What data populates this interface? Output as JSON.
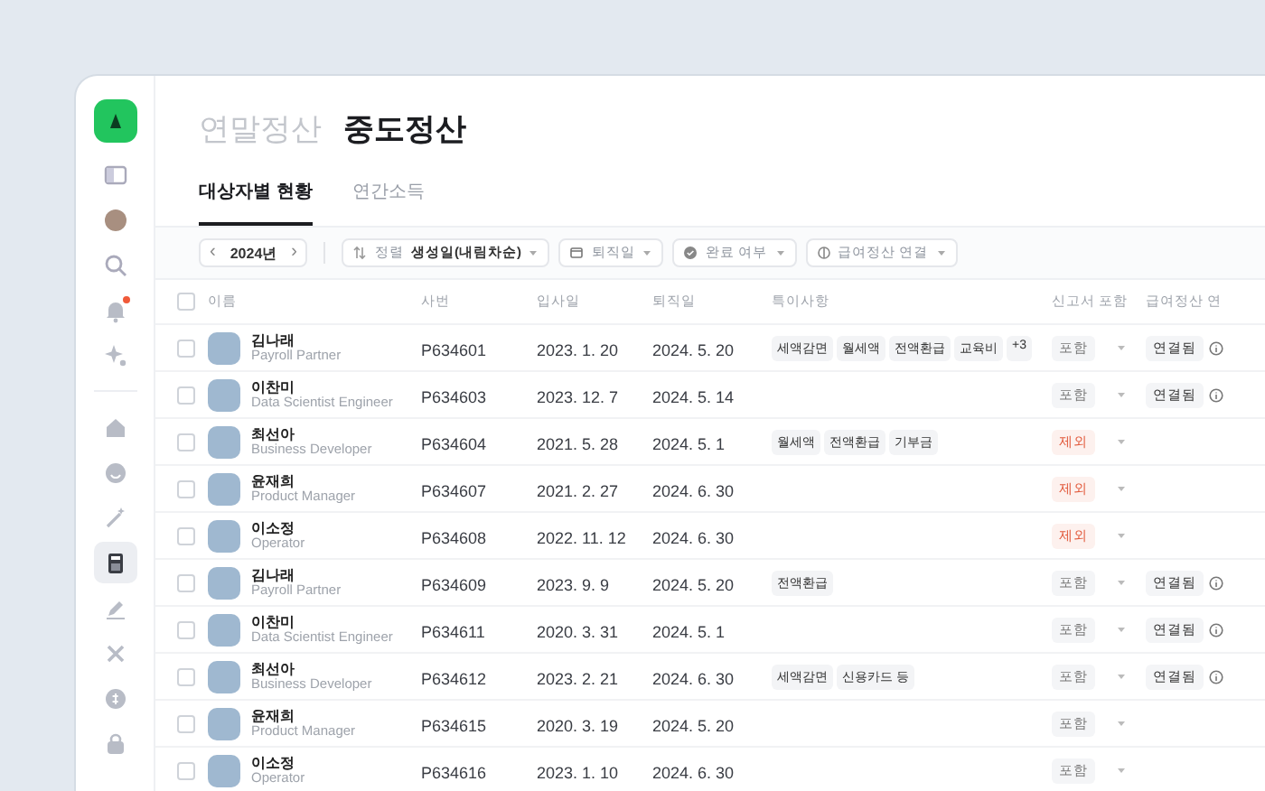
{
  "sidebar": {
    "items": [
      {
        "selected": false,
        "alert": false
      },
      {
        "selected": false,
        "alert": false
      },
      {
        "selected": false,
        "alert": false
      },
      {
        "selected": false,
        "alert": true
      },
      {
        "selected": false,
        "alert": false
      },
      {
        "selected": false,
        "alert": false
      },
      {
        "selected": false,
        "alert": false
      },
      {
        "selected": false,
        "alert": false
      },
      {
        "selected": true,
        "alert": false
      },
      {
        "selected": false,
        "alert": false
      },
      {
        "selected": false,
        "alert": false
      },
      {
        "selected": false,
        "alert": false
      },
      {
        "selected": false,
        "alert": false
      }
    ]
  },
  "title_tabs": [
    {
      "label": "연말정산",
      "selected": false
    },
    {
      "label": "중도정산",
      "selected": true
    }
  ],
  "tabs": [
    {
      "label": "대상자별 현황",
      "selected": true
    },
    {
      "label": "연간소득",
      "selected": false
    }
  ],
  "filters": {
    "year": "2024년",
    "prev": "‹",
    "next": "›",
    "dropdowns": [
      {
        "label": "정렬",
        "value": "생성일(내림차순)"
      },
      {
        "label": "퇴직일"
      },
      {
        "label": "완료 여부"
      },
      {
        "label": "급여정산 연결"
      }
    ]
  },
  "table": {
    "header_checked": false,
    "columns": [
      "이름",
      "사번",
      "입사일",
      "퇴직일",
      "특이사항",
      "신고서 포함",
      "급여정산 연"
    ],
    "rows": [
      {
        "checked": false,
        "name": "김나래",
        "role": "Payroll Partner",
        "id": "P634601",
        "hired": "2023. 1. 20",
        "left": "2024. 5. 20",
        "notes": [
          "세액감면",
          "월세액",
          "전액환급",
          "교육비",
          "+3"
        ],
        "report": "포함",
        "included": true,
        "link": "연결됨"
      },
      {
        "checked": false,
        "name": "이찬미",
        "role": "Data Scientist Engineer",
        "id": "P634603",
        "hired": "2023. 12. 7",
        "left": "2024. 5. 14",
        "notes": [],
        "report": "포함",
        "included": true,
        "link": "연결됨"
      },
      {
        "checked": false,
        "name": "최선아",
        "role": "Business Developer",
        "id": "P634604",
        "hired": "2021. 5. 28",
        "left": "2024. 5. 1",
        "notes": [
          "월세액",
          "전액환급",
          "기부금"
        ],
        "report": "제외",
        "included": false
      },
      {
        "checked": false,
        "name": "윤재희",
        "role": "Product Manager",
        "id": "P634607",
        "hired": "2021. 2. 27",
        "left": "2024. 6. 30",
        "notes": [],
        "report": "제외",
        "included": false
      },
      {
        "checked": false,
        "name": "이소정",
        "role": "Operator",
        "id": "P634608",
        "hired": "2022. 11. 12",
        "left": "2024. 6. 30",
        "notes": [],
        "report": "제외",
        "included": false
      },
      {
        "checked": false,
        "name": "김나래",
        "role": "Payroll Partner",
        "id": "P634609",
        "hired": "2023. 9. 9",
        "left": "2024. 5. 20",
        "notes": [
          "전액환급"
        ],
        "report": "포함",
        "included": true,
        "link": "연결됨"
      },
      {
        "checked": false,
        "name": "이찬미",
        "role": "Data Scientist Engineer",
        "id": "P634611",
        "hired": "2020. 3. 31",
        "left": "2024. 5. 1",
        "notes": [],
        "report": "포함",
        "included": true,
        "link": "연결됨"
      },
      {
        "checked": false,
        "name": "최선아",
        "role": "Business Developer",
        "id": "P634612",
        "hired": "2023. 2. 21",
        "left": "2024. 6. 30",
        "notes": [
          "세액감면",
          "신용카드 등"
        ],
        "report": "포함",
        "included": true,
        "link": "연결됨"
      },
      {
        "checked": false,
        "name": "윤재희",
        "role": "Product Manager",
        "id": "P634615",
        "hired": "2020. 3. 19",
        "left": "2024. 5. 20",
        "notes": [],
        "report": "포함",
        "included": true
      },
      {
        "checked": false,
        "name": "이소정",
        "role": "Operator",
        "id": "P634616",
        "hired": "2023. 1. 10",
        "left": "2024. 6. 30",
        "notes": [],
        "report": "포함",
        "included": true
      }
    ]
  }
}
